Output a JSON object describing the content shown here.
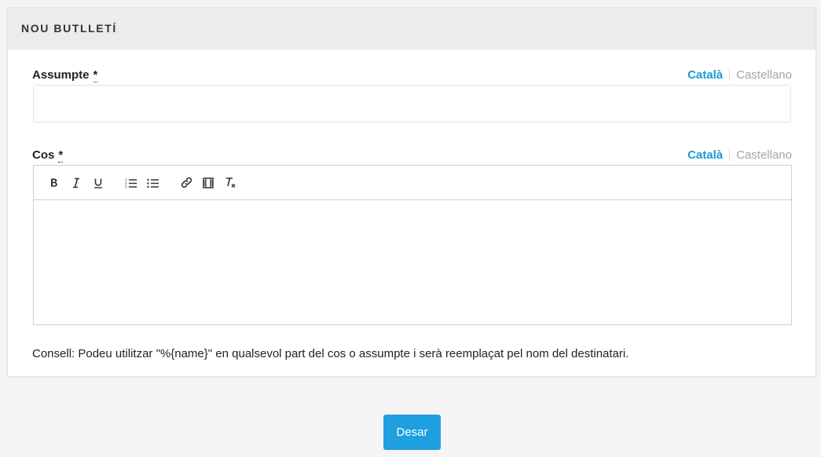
{
  "card": {
    "title": "NOU BUTLLETÍ"
  },
  "subject": {
    "label": "Assumpte",
    "required_mark": "*",
    "value": "",
    "placeholder": "",
    "languages": {
      "active": "Català",
      "inactive": "Castellano"
    }
  },
  "body": {
    "label": "Cos",
    "required_mark": "*",
    "value": "",
    "languages": {
      "active": "Català",
      "inactive": "Castellano"
    },
    "toolbar": [
      "bold-icon",
      "italic-icon",
      "underline-icon",
      "ordered-list-icon",
      "bullet-list-icon",
      "link-icon",
      "video-icon",
      "clear-format-icon"
    ]
  },
  "hint": "Consell: Podeu utilitzar \"%{name}\" en qualsevol part del cos o assumpte i serà reemplaçat pel nom del destinatari.",
  "actions": {
    "save_label": "Desar"
  },
  "colors": {
    "accent": "#1a9ad6",
    "button": "#1d9fe0",
    "header_bg": "#ececec",
    "page_bg": "#f4f4f4"
  }
}
